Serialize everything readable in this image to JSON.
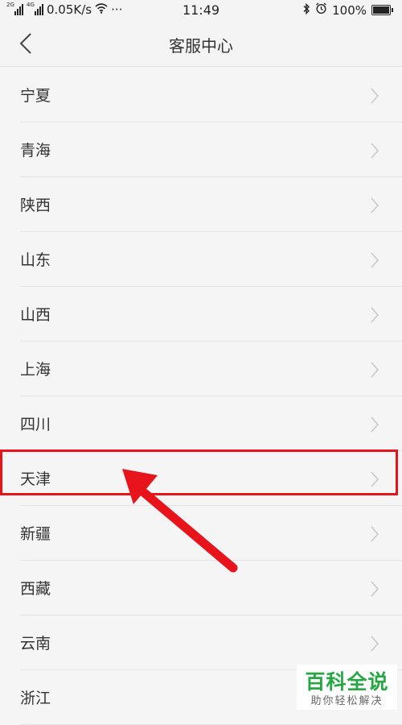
{
  "status_bar": {
    "network_label": "2G 4G",
    "speed": "0.05K/s",
    "more": "···",
    "time": "11:49",
    "battery": "100%"
  },
  "header": {
    "title": "客服中心"
  },
  "regions": [
    {
      "label": "宁夏"
    },
    {
      "label": "青海"
    },
    {
      "label": "陕西"
    },
    {
      "label": "山东"
    },
    {
      "label": "山西"
    },
    {
      "label": "上海"
    },
    {
      "label": "四川"
    },
    {
      "label": "天津"
    },
    {
      "label": "新疆"
    },
    {
      "label": "西藏"
    },
    {
      "label": "云南"
    },
    {
      "label": "浙江"
    }
  ],
  "annotation": {
    "highlighted_item": "天津",
    "color": "#e8141b"
  },
  "watermark": {
    "title": "百科全说",
    "subtitle": "助你轻松解决",
    "color": "#27a744"
  }
}
